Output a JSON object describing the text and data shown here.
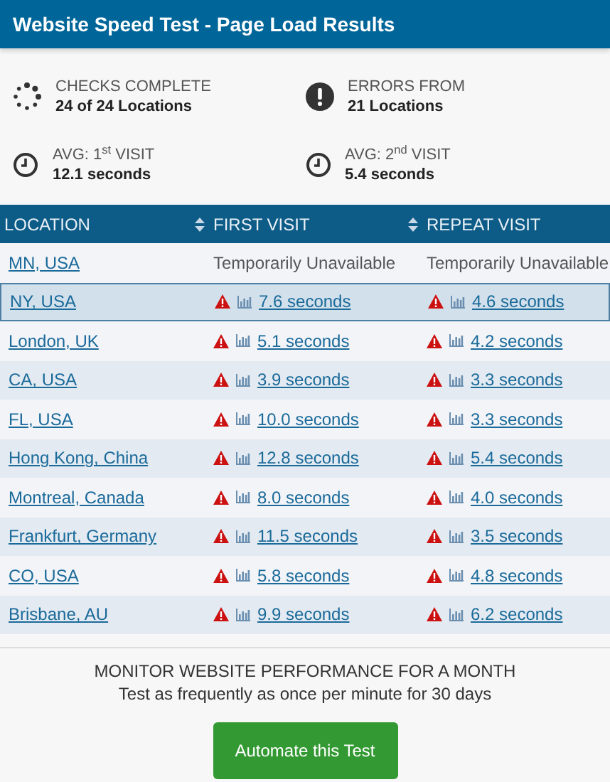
{
  "title": "Website Speed Test - Page Load Results",
  "stats": [
    {
      "kind": "progress",
      "label": "CHECKS COMPLETE",
      "value": "24 of 24 Locations"
    },
    {
      "kind": "error",
      "label": "ERRORS FROM",
      "value": "21 Locations"
    },
    {
      "kind": "clock",
      "label": "AVG: 1$^{st}$ VISIT",
      "value": "12.1 seconds"
    },
    {
      "kind": "clock",
      "label": "AVG: 2$^{nd}$ VISIT",
      "value": "5.4 seconds"
    }
  ],
  "table": {
    "columns": [
      {
        "label": "LOCATION",
        "sortable": false
      },
      {
        "label": "FIRST VISIT",
        "sortable": true
      },
      {
        "label": "REPEAT VISIT",
        "sortable": true
      }
    ],
    "rows": [
      {
        "location": "MN, USA",
        "selected": false,
        "cells": [
          {
            "kind": "status",
            "text": "Temporarily Unavailable"
          },
          {
            "kind": "status",
            "text": "Temporarily Unavailable"
          }
        ]
      },
      {
        "location": "NY, USA",
        "selected": true,
        "cells": [
          {
            "kind": "timing",
            "text": "7.6 seconds"
          },
          {
            "kind": "timing",
            "text": "4.6 seconds"
          }
        ]
      },
      {
        "location": "London, UK",
        "selected": false,
        "cells": [
          {
            "kind": "timing",
            "text": "5.1 seconds"
          },
          {
            "kind": "timing",
            "text": "4.2 seconds"
          }
        ]
      },
      {
        "location": "CA, USA",
        "selected": false,
        "cells": [
          {
            "kind": "timing",
            "text": "3.9 seconds"
          },
          {
            "kind": "timing",
            "text": "3.3 seconds"
          }
        ]
      },
      {
        "location": "FL, USA",
        "selected": false,
        "cells": [
          {
            "kind": "timing",
            "text": "10.0 seconds"
          },
          {
            "kind": "timing",
            "text": "3.3 seconds"
          }
        ]
      },
      {
        "location": "Hong Kong, China",
        "selected": false,
        "cells": [
          {
            "kind": "timing",
            "text": "12.8 seconds"
          },
          {
            "kind": "timing",
            "text": "5.4 seconds"
          }
        ]
      },
      {
        "location": "Montreal, Canada",
        "selected": false,
        "cells": [
          {
            "kind": "timing",
            "text": "8.0 seconds"
          },
          {
            "kind": "timing",
            "text": "4.0 seconds"
          }
        ]
      },
      {
        "location": "Frankfurt, Germany",
        "selected": false,
        "cells": [
          {
            "kind": "timing",
            "text": "11.5 seconds"
          },
          {
            "kind": "timing",
            "text": "3.5 seconds"
          }
        ]
      },
      {
        "location": "CO, USA",
        "selected": false,
        "cells": [
          {
            "kind": "timing",
            "text": "5.8 seconds"
          },
          {
            "kind": "timing",
            "text": "4.8 seconds"
          }
        ]
      },
      {
        "location": "Brisbane, AU",
        "selected": false,
        "cells": [
          {
            "kind": "timing",
            "text": "9.9 seconds"
          },
          {
            "kind": "timing",
            "text": "6.2 seconds"
          }
        ]
      }
    ]
  },
  "footer": {
    "heading": "MONITOR WEBSITE PERFORMANCE FOR A MONTH",
    "text": "Test as frequently as once per minute for 30 days",
    "button": "Automate this Test"
  }
}
